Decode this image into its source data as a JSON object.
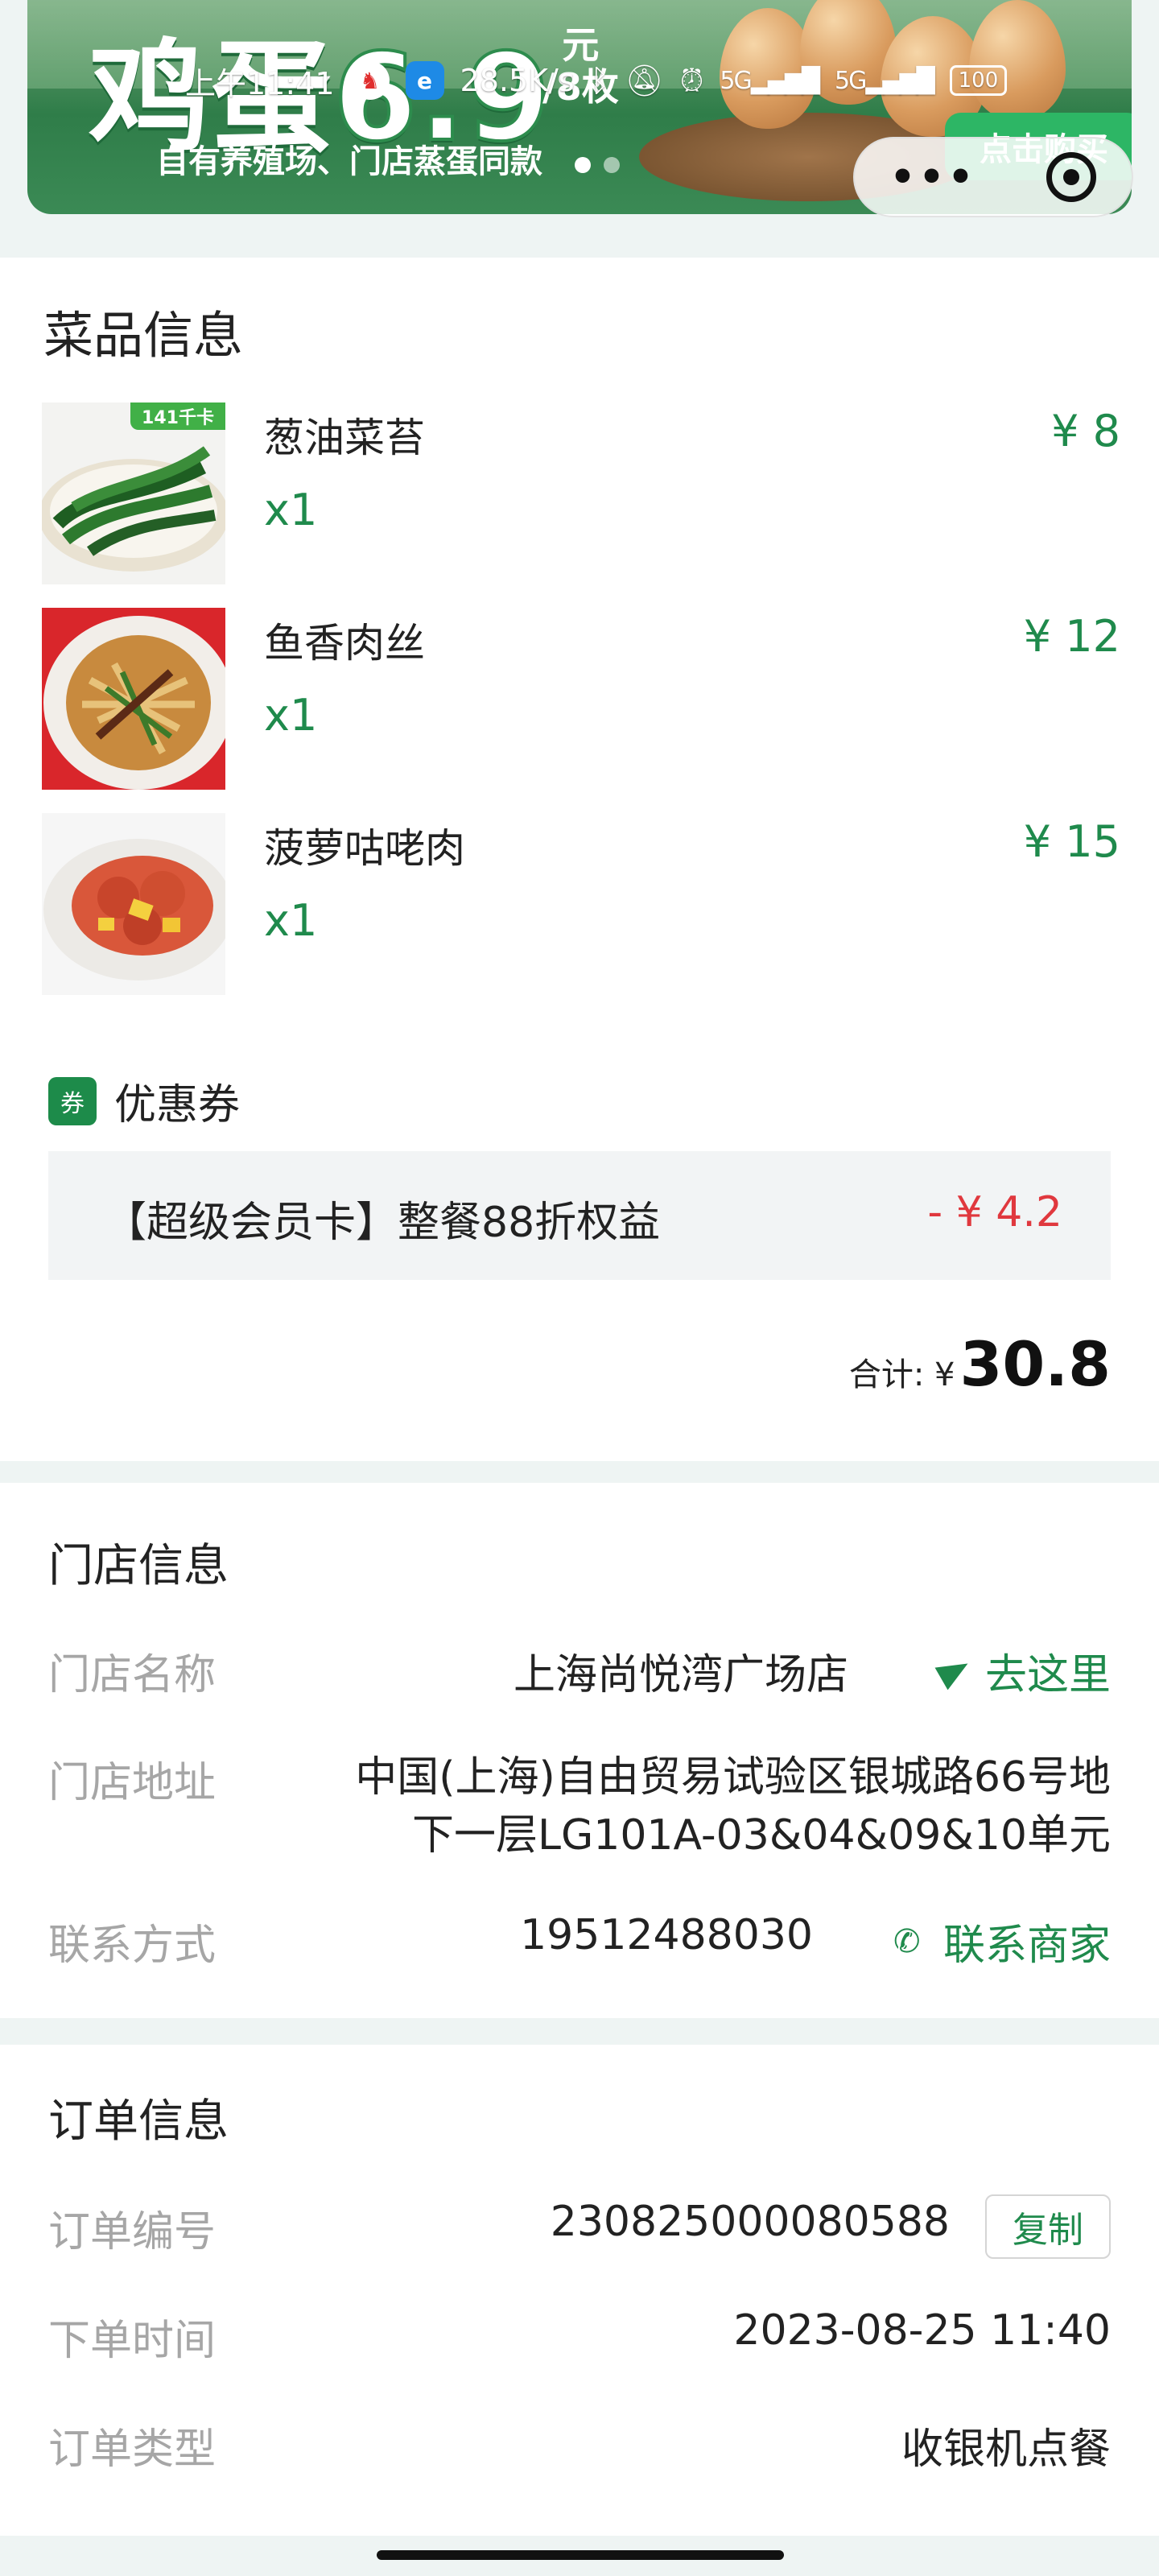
{
  "banner": {
    "title_main": "鸡蛋",
    "title_price": "6.9",
    "title_unit_top": "元",
    "title_unit_bottom": "/8枚",
    "subtitle": "自有养殖场、门店蒸蛋同款",
    "buy_label": "点击购买"
  },
  "status_bar": {
    "time": "上午11:41",
    "speed": "28.5K/s",
    "net1": "5G",
    "net2": "5G",
    "battery": "100"
  },
  "dishes_section": {
    "title": "菜品信息",
    "items": [
      {
        "name": "葱油菜苔",
        "qty": "x1",
        "price": "¥ 8",
        "badge": "141千卡"
      },
      {
        "name": "鱼香肉丝",
        "qty": "x1",
        "price": "¥ 12"
      },
      {
        "name": "菠萝咕咾肉",
        "qty": "x1",
        "price": "¥ 15"
      }
    ],
    "coupon_tag": "券",
    "coupon_label": "优惠券",
    "coupon_text": "【超级会员卡】整餐88折权益",
    "coupon_discount": "- ¥ 4.2",
    "total_label": "合计: ¥",
    "total_value": "30.8"
  },
  "store_section": {
    "title": "门店信息",
    "name_label": "门店名称",
    "name_value": "上海尚悦湾广场店",
    "go_label": "去这里",
    "address_label": "门店地址",
    "address_line1": "中国(上海)自由贸易试验区银城路66号地",
    "address_line2": "下一层LG101A-03&04&09&10单元",
    "contact_label": "联系方式",
    "contact_value": "19512488030",
    "contact_action": "联系商家"
  },
  "order_section": {
    "title": "订单信息",
    "no_label": "订单编号",
    "no_value": "230825000080588",
    "copy_label": "复制",
    "time_label": "下单时间",
    "time_value": "2023-08-25 11:40",
    "type_label": "订单类型",
    "type_value": "收银机点餐"
  },
  "colors": {
    "accent_green": "#1f8a4c",
    "discount_red": "#e0383e",
    "label_gray": "#a6a6a6"
  }
}
